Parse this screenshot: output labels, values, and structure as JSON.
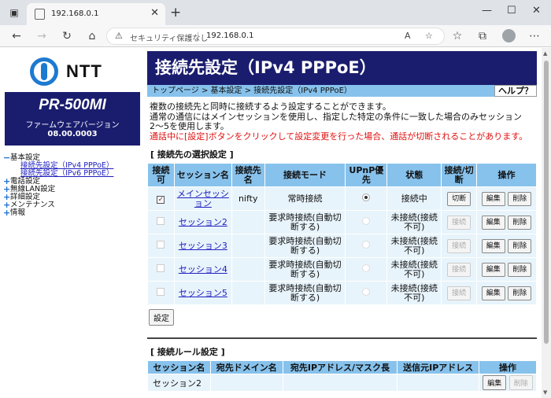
{
  "browser": {
    "tab_title": "192.168.0.1",
    "security_label": "セキュリティ保護なし",
    "url": "192.168.0.1"
  },
  "sidebar": {
    "logo_text": "NTT",
    "model": "PR-500MI",
    "fw_label": "ファームウェアバージョン",
    "fw_version": "08.00.0003",
    "nav": [
      {
        "label": "基本設定",
        "marker": "−"
      },
      {
        "label": "接続先設定（IPv4 PPPoE）",
        "sub": true
      },
      {
        "label": "接続先設定（IPv6 PPPoE）",
        "sub": true
      },
      {
        "label": "電話設定",
        "marker": "+"
      },
      {
        "label": "無線LAN設定",
        "marker": "+"
      },
      {
        "label": "詳細設定",
        "marker": "+"
      },
      {
        "label": "メンテナンス",
        "marker": "+"
      },
      {
        "label": "情報",
        "marker": "+"
      }
    ]
  },
  "main": {
    "title": "接続先設定（IPv4 PPPoE）",
    "breadcrumb": "トップページ > 基本設定 > 接続先設定（IPv4 PPPoE）",
    "help": "ヘルプ？",
    "desc1": "複数の接続先と同時に接続するよう設定することができます。",
    "desc2": "通常の通信にはメインセッションを使用し、指定した特定の条件に一致した場合のみセッション2〜5を使用します。",
    "warning": "通話中に[設定]ボタンをクリックして設定変更を行った場合、通話が切断されることがあります。",
    "section1": "[ 接続先の選択設定 ]",
    "cols1": [
      "接続可",
      "セッション名",
      "接続先名",
      "接続モード",
      "UPnP優先",
      "状態",
      "接続/切断",
      "操作"
    ],
    "rows": [
      {
        "session": "メインセッション",
        "dest": "nifty",
        "mode": "常時接続",
        "status": "接続中",
        "conn_btn": "切断",
        "edit": "編集",
        "del": "削除",
        "enabled": true
      },
      {
        "session": "セッション2",
        "dest": "",
        "mode": "要求時接続(自動切断する)",
        "status": "未接続(接続不可)",
        "conn_btn": "接続",
        "edit": "編集",
        "del": "削除",
        "enabled": false
      },
      {
        "session": "セッション3",
        "dest": "",
        "mode": "要求時接続(自動切断する)",
        "status": "未接続(接続不可)",
        "conn_btn": "接続",
        "edit": "編集",
        "del": "削除",
        "enabled": false
      },
      {
        "session": "セッション4",
        "dest": "",
        "mode": "要求時接続(自動切断する)",
        "status": "未接続(接続不可)",
        "conn_btn": "接続",
        "edit": "編集",
        "del": "削除",
        "enabled": false
      },
      {
        "session": "セッション5",
        "dest": "",
        "mode": "要求時接続(自動切断する)",
        "status": "未接続(接続不可)",
        "conn_btn": "接続",
        "edit": "編集",
        "del": "削除",
        "enabled": false
      }
    ],
    "set_button": "設定",
    "section2": "[ 接続ルール設定 ]",
    "cols2": [
      "セッション名",
      "宛先ドメイン名",
      "宛先IPアドレス/マスク長",
      "送信元IPアドレス",
      "操作"
    ],
    "rule_row": {
      "session": "セッション2",
      "edit": "編集",
      "del": "削除"
    }
  }
}
